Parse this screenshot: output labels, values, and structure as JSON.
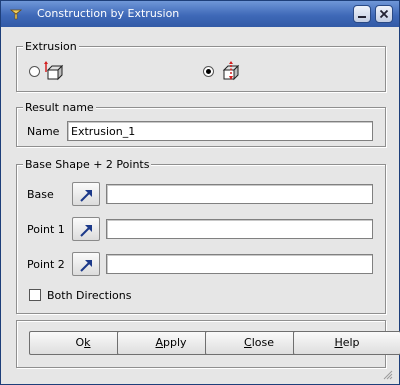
{
  "window": {
    "title": "Construction by Extrusion"
  },
  "extrusion_group": {
    "legend": "Extrusion",
    "options": [
      {
        "selected": false,
        "icon": "extrude-single-direction-icon"
      },
      {
        "selected": true,
        "icon": "extrude-two-directions-icon"
      }
    ]
  },
  "result_group": {
    "legend": "Result name",
    "name_label": "Name",
    "name_value": "Extrusion_1"
  },
  "shape_group": {
    "legend": "Base Shape + 2 Points",
    "base_label": "Base",
    "base_value": "",
    "point1_label": "Point 1",
    "point1_value": "",
    "point2_label": "Point 2",
    "point2_value": "",
    "select_icon": "select-arrow-icon",
    "both_directions_label": "Both Directions",
    "both_directions_checked": false
  },
  "buttons": {
    "ok": {
      "pre": "O",
      "u": "k",
      "post": ""
    },
    "apply": {
      "pre": "",
      "u": "A",
      "post": "pply"
    },
    "close": {
      "pre": "",
      "u": "C",
      "post": "lose"
    },
    "help": {
      "pre": "",
      "u": "H",
      "post": "elp"
    }
  },
  "colors": {
    "titlebar": "#3f69b8",
    "dialog_bg": "#e6e6e6",
    "select_arrow": "#1d3a8a",
    "extrude_red": "#d42020"
  }
}
